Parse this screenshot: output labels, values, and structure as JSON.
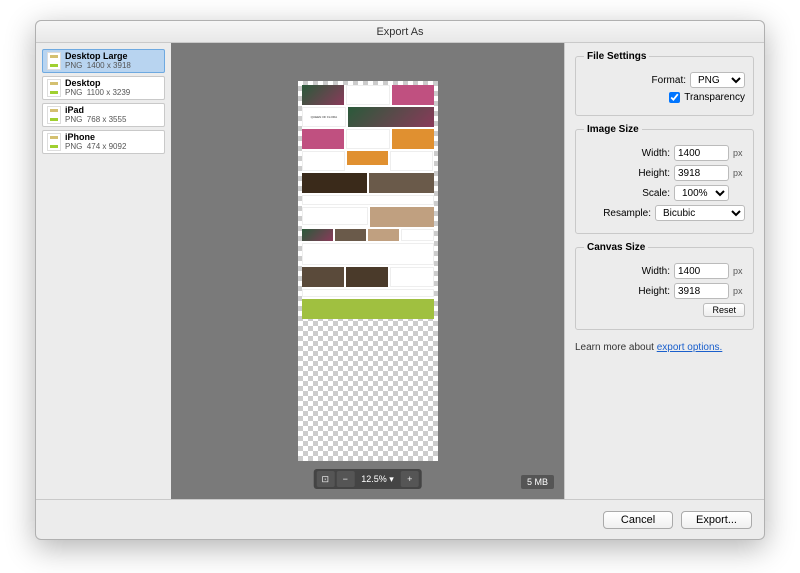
{
  "window": {
    "title": "Export As"
  },
  "artboards": [
    {
      "name": "Desktop Large",
      "format": "PNG",
      "dims": "1400 x 3918",
      "selected": true
    },
    {
      "name": "Desktop",
      "format": "PNG",
      "dims": "1100 x 3239",
      "selected": false
    },
    {
      "name": "iPad",
      "format": "PNG",
      "dims": "768 x 3555",
      "selected": false
    },
    {
      "name": "iPhone",
      "format": "PNG",
      "dims": "474 x 9092",
      "selected": false
    }
  ],
  "preview": {
    "filesize": "5 MB",
    "zoom": "12.5%",
    "mock_title": "QUEEN OF FLORA"
  },
  "file_settings": {
    "legend": "File Settings",
    "format_label": "Format:",
    "format_value": "PNG",
    "transparency_label": "Transparency",
    "transparency_checked": true
  },
  "image_size": {
    "legend": "Image Size",
    "width_label": "Width:",
    "width_value": "1400",
    "height_label": "Height:",
    "height_value": "3918",
    "scale_label": "Scale:",
    "scale_value": "100%",
    "resample_label": "Resample:",
    "resample_value": "Bicubic",
    "px": "px"
  },
  "canvas_size": {
    "legend": "Canvas Size",
    "width_label": "Width:",
    "width_value": "1400",
    "height_label": "Height:",
    "height_value": "3918",
    "px": "px",
    "reset_label": "Reset"
  },
  "learn_more": {
    "prefix": "Learn more about ",
    "link": "export options."
  },
  "footer": {
    "cancel": "Cancel",
    "export": "Export..."
  }
}
